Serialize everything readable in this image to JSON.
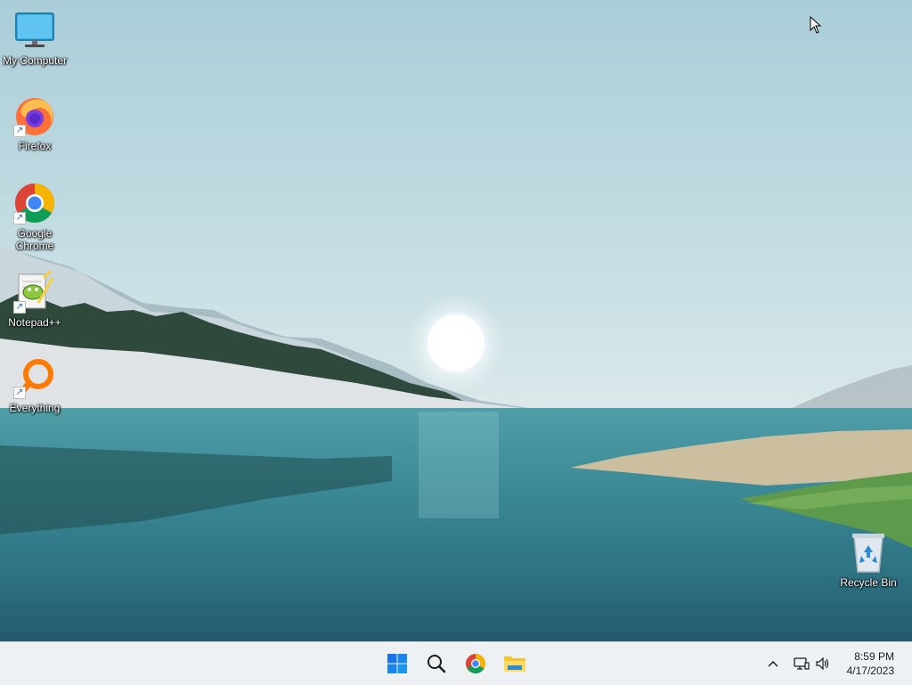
{
  "desktop": {
    "icons": [
      {
        "label": "My Computer",
        "icon": "monitor-icon"
      },
      {
        "label": "Firefox",
        "icon": "firefox-icon"
      },
      {
        "label": "Google Chrome",
        "icon": "chrome-icon"
      },
      {
        "label": "Notepad++",
        "icon": "notepadpp-icon"
      },
      {
        "label": "Everything",
        "icon": "everything-search-icon"
      },
      {
        "label": "Recycle Bin",
        "icon": "recycle-bin-icon"
      }
    ]
  },
  "taskbar": {
    "pinned": [
      {
        "name": "Start",
        "icon": "windows-start-icon"
      },
      {
        "name": "Search",
        "icon": "search-icon"
      },
      {
        "name": "Google Chrome",
        "icon": "chrome-icon"
      },
      {
        "name": "File Explorer",
        "icon": "folder-icon"
      }
    ],
    "tray": {
      "chevron_icon": "chevron-up-icon",
      "network_icon": "network-icon",
      "volume_icon": "volume-icon"
    },
    "clock": {
      "time": "8:59 PM",
      "date": "4/17/2023"
    }
  },
  "colors": {
    "taskbar_bg": "#eef1f3",
    "windows_blue": "#1a73e8",
    "folder_yellow": "#f4c430"
  }
}
